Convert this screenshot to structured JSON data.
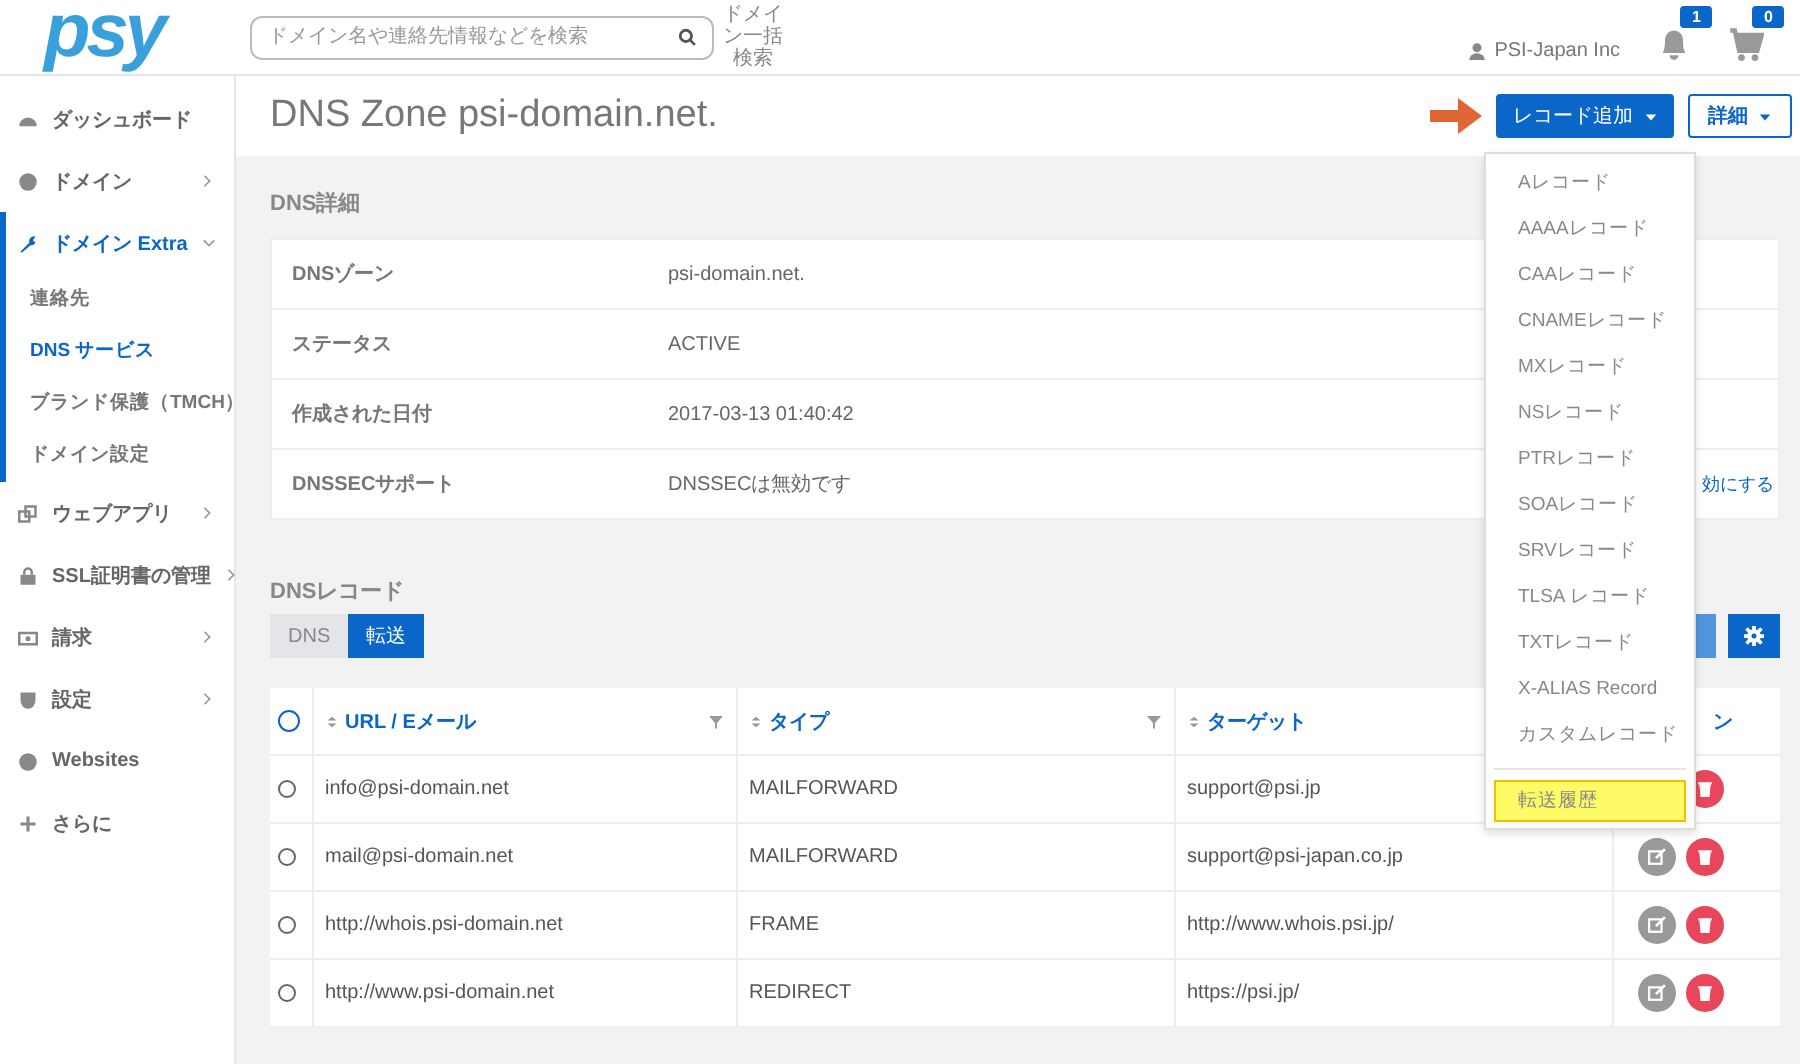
{
  "header": {
    "logo": "psy",
    "search": {
      "placeholder": "ドメイン名や連絡先情報などを検索"
    },
    "bulk_search": "ドメイン一括検索",
    "user": "PSI-Japan Inc",
    "notifications": "1",
    "cart": "0"
  },
  "sidebar": {
    "items": [
      {
        "label": "ダッシュボード",
        "has_submenu": false,
        "expanded": false,
        "selected": false
      },
      {
        "label": "ドメイン",
        "has_submenu": true,
        "expanded": false,
        "selected": false
      },
      {
        "label": "ドメイン Extra",
        "has_submenu": true,
        "expanded": true,
        "selected": true,
        "children": [
          {
            "label": "連絡先",
            "selected": false
          },
          {
            "label": "DNS サービス",
            "selected": true
          },
          {
            "label": "ブランド保護（TMCH）",
            "selected": false
          },
          {
            "label": "ドメイン設定",
            "selected": false
          }
        ]
      },
      {
        "label": "ウェブアプリ",
        "has_submenu": true,
        "expanded": false,
        "selected": false
      },
      {
        "label": "SSL証明書の管理",
        "has_submenu": true,
        "expanded": false,
        "selected": false
      },
      {
        "label": "請求",
        "has_submenu": true,
        "expanded": false,
        "selected": false
      },
      {
        "label": "設定",
        "has_submenu": true,
        "expanded": false,
        "selected": false
      },
      {
        "label": "Websites",
        "has_submenu": false,
        "expanded": false,
        "selected": false
      },
      {
        "label": "さらに",
        "has_submenu": false,
        "expanded": false,
        "selected": false
      }
    ]
  },
  "page": {
    "title": "DNS Zone psi-domain.net.",
    "add_record_button": "レコード追加",
    "details_button": "詳細"
  },
  "record_menu": {
    "items": [
      {
        "label": "Aレコード",
        "highlighted": false
      },
      {
        "label": "AAAAレコード",
        "highlighted": false
      },
      {
        "label": "CAAレコード",
        "highlighted": false
      },
      {
        "label": "CNAMEレコード",
        "highlighted": false
      },
      {
        "label": "MXレコード",
        "highlighted": false
      },
      {
        "label": "NSレコード",
        "highlighted": false
      },
      {
        "label": "PTRレコード",
        "highlighted": false
      },
      {
        "label": "SOAレコード",
        "highlighted": false
      },
      {
        "label": "SRVレコード",
        "highlighted": false
      },
      {
        "label": "TLSA レコード",
        "highlighted": false
      },
      {
        "label": "TXTレコード",
        "highlighted": false
      },
      {
        "label": "X-ALIAS Record",
        "highlighted": false
      },
      {
        "label": "カスタムレコード",
        "highlighted": false
      }
    ],
    "footer_item": {
      "label": "転送履歴",
      "highlighted": true
    }
  },
  "dns_details": {
    "heading": "DNS詳細",
    "rows": [
      {
        "label": "DNSゾーン",
        "value": "psi-domain.net."
      },
      {
        "label": "ステータス",
        "value": "ACTIVE"
      },
      {
        "label": "作成された日付",
        "value": "2017-03-13 01:40:42"
      },
      {
        "label": "DNSSECサポート",
        "value": "DNSSECは無効です",
        "link": "効にする"
      }
    ]
  },
  "dns_records": {
    "heading": "DNSレコード",
    "tabs": [
      {
        "label": "DNS",
        "selected": false
      },
      {
        "label": "転送",
        "selected": true
      }
    ],
    "all_selected": false,
    "columns": [
      {
        "label": "URL / Eメール",
        "sortable": true,
        "filterable": true
      },
      {
        "label": "タイプ",
        "sortable": true,
        "filterable": true
      },
      {
        "label": "ターゲット",
        "sortable": true,
        "filterable": false
      },
      {
        "label": "ン",
        "sortable": false,
        "filterable": false
      }
    ],
    "rows": [
      {
        "selected": false,
        "cells": [
          "info@psi-domain.net",
          "MAILFORWARD",
          "support@psi.jp"
        ],
        "actions": [
          {
            "kind": "delete"
          }
        ]
      },
      {
        "selected": false,
        "cells": [
          "mail@psi-domain.net",
          "MAILFORWARD",
          "support@psi-japan.co.jp"
        ],
        "actions": [
          {
            "kind": "edit"
          },
          {
            "kind": "delete"
          }
        ]
      },
      {
        "selected": false,
        "cells": [
          "http://whois.psi-domain.net",
          "FRAME",
          "http://www.whois.psi.jp/"
        ],
        "actions": [
          {
            "kind": "edit"
          },
          {
            "kind": "delete"
          }
        ]
      },
      {
        "selected": false,
        "cells": [
          "http://www.psi-domain.net",
          "REDIRECT",
          "https://psi.jp/"
        ],
        "actions": [
          {
            "kind": "edit"
          },
          {
            "kind": "delete"
          }
        ]
      }
    ]
  }
}
